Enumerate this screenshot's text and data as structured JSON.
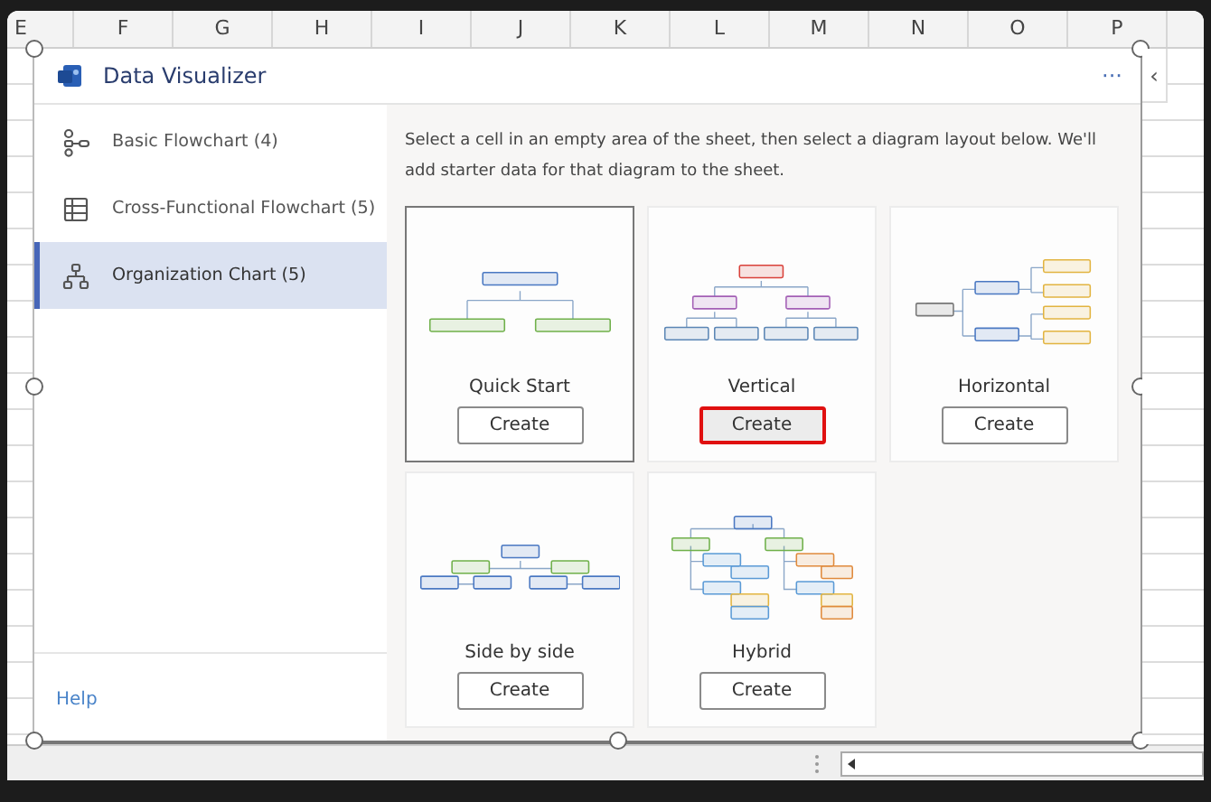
{
  "sheet": {
    "columns": [
      "E",
      "F",
      "G",
      "H",
      "I",
      "J",
      "K",
      "L",
      "M",
      "N",
      "O",
      "P"
    ]
  },
  "pane": {
    "title": "Data Visualizer",
    "more": "···",
    "collapse": "‹"
  },
  "sidebar": {
    "items": [
      {
        "label": "Basic Flowchart (4)",
        "kind": "flowchart",
        "selected": false
      },
      {
        "label": "Cross-Functional Flowchart (5)",
        "kind": "table",
        "selected": false
      },
      {
        "label": "Organization Chart (5)",
        "kind": "org",
        "selected": true
      }
    ],
    "help": "Help"
  },
  "intro": "Select a cell in an empty area of the sheet, then select a diagram layout below. We'll add starter data for that diagram to the sheet.",
  "cards": [
    {
      "title": "Quick Start",
      "kind": "quick_start",
      "button": "Create",
      "selected": true,
      "highlighted": false
    },
    {
      "title": "Vertical",
      "kind": "vertical",
      "button": "Create",
      "selected": false,
      "highlighted": true
    },
    {
      "title": "Horizontal",
      "kind": "horizontal",
      "button": "Create",
      "selected": false,
      "highlighted": false
    },
    {
      "title": "Side by side",
      "kind": "side_by_side",
      "button": "Create",
      "selected": false,
      "highlighted": false
    },
    {
      "title": "Hybrid",
      "kind": "hybrid",
      "button": "Create",
      "selected": false,
      "highlighted": false
    }
  ]
}
